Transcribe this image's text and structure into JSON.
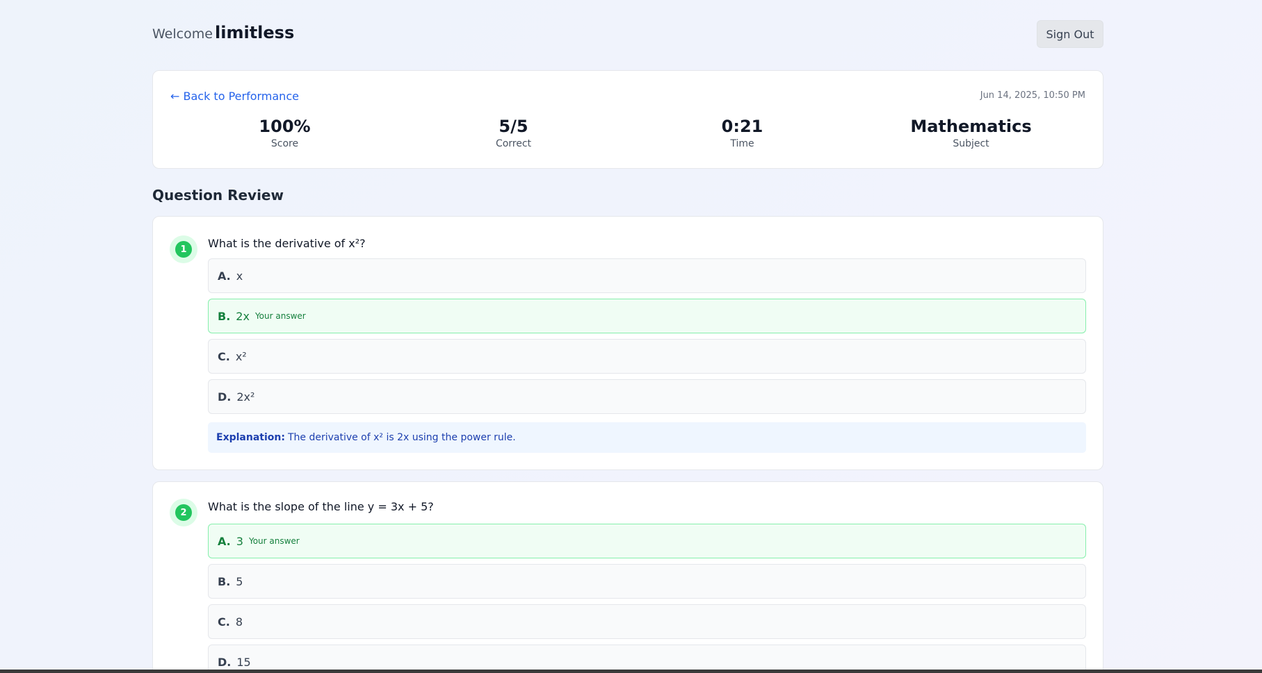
{
  "header": {
    "welcome_label": "Welcome",
    "username": "limitless",
    "sign_out_label": "Sign Out"
  },
  "summary": {
    "back_label": "← Back to Performance",
    "date": "Jun 14, 2025, 10:50 PM",
    "stats": [
      {
        "value": "100%",
        "label": "Score"
      },
      {
        "value": "5/5",
        "label": "Correct"
      },
      {
        "value": "0:21",
        "label": "Time"
      },
      {
        "value": "Mathematics",
        "label": "Subject"
      }
    ]
  },
  "review": {
    "title": "Question Review",
    "your_answer_label": "Your answer",
    "explanation_label": "Explanation:",
    "questions": [
      {
        "number": "1",
        "text": "What is the derivative of x²?",
        "options": [
          {
            "letter": "A.",
            "text": "x"
          },
          {
            "letter": "B.",
            "text": "2x",
            "selected": true
          },
          {
            "letter": "C.",
            "text": "x²"
          },
          {
            "letter": "D.",
            "text": "2x²"
          }
        ],
        "explanation": "The derivative of x² is 2x using the power rule."
      },
      {
        "number": "2",
        "text": "What is the slope of the line y = 3x + 5?",
        "options": [
          {
            "letter": "A.",
            "text": "3",
            "selected": true
          },
          {
            "letter": "B.",
            "text": "5"
          },
          {
            "letter": "C.",
            "text": "8"
          },
          {
            "letter": "D.",
            "text": "15"
          }
        ]
      }
    ]
  },
  "colors": {
    "accent_link": "#2563eb",
    "correct_green": "#22c55e",
    "selected_bg": "#f0fdf4",
    "explanation_bg": "#eff6ff"
  }
}
